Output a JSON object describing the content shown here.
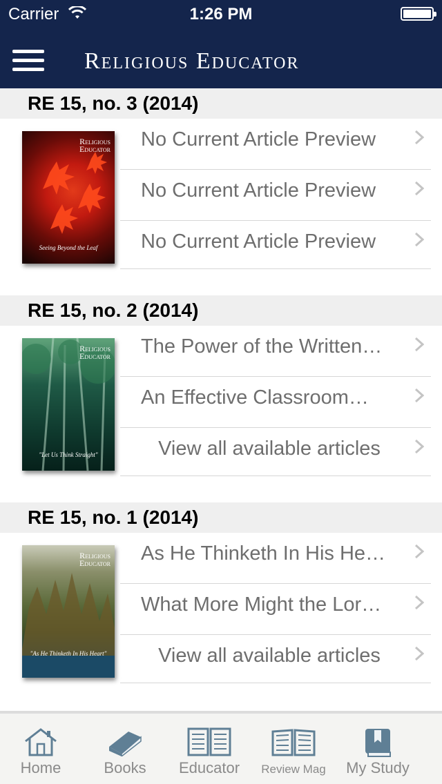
{
  "status_bar": {
    "carrier": "Carrier",
    "time": "1:26 PM"
  },
  "nav": {
    "title": "Religious Educator"
  },
  "sections": [
    {
      "header": "RE 15, no. 3 (2014)",
      "cover": {
        "title_line1": "Religious",
        "title_line2": "Educator",
        "caption": "Seeing Beyond the Leaf"
      },
      "rows": [
        "No Current Article Preview",
        "No Current Article Preview",
        "No Current Article Preview"
      ]
    },
    {
      "header": "RE 15, no. 2 (2014)",
      "cover": {
        "title_line1": "Religious",
        "title_line2": "Educator",
        "caption": "\"Let Us Think Straight\""
      },
      "rows": [
        "The Power of the Written…",
        "An Effective Classroom…",
        "View all available articles"
      ]
    },
    {
      "header": "RE 15, no. 1 (2014)",
      "cover": {
        "title_line1": "Religious",
        "title_line2": "Educator",
        "caption": "\"As He Thinketh In His Heart\""
      },
      "rows": [
        "As He Thinketh In His He…",
        "What More Might the Lor…",
        "View all available articles"
      ]
    }
  ],
  "tabbar": {
    "tabs": [
      {
        "label": "Home",
        "icon": "home-icon"
      },
      {
        "label": "Books",
        "icon": "book-icon"
      },
      {
        "label": "Educator",
        "icon": "open-book-icon"
      },
      {
        "label": "Review Mag",
        "icon": "open-magazine-icon"
      },
      {
        "label": "My Study",
        "icon": "bookmark-book-icon"
      }
    ]
  },
  "colors": {
    "nav_bg": "#14254c",
    "section_header_bg": "#efefef",
    "row_text": "#6e6e6e",
    "tab_text": "#8a8a8a"
  }
}
